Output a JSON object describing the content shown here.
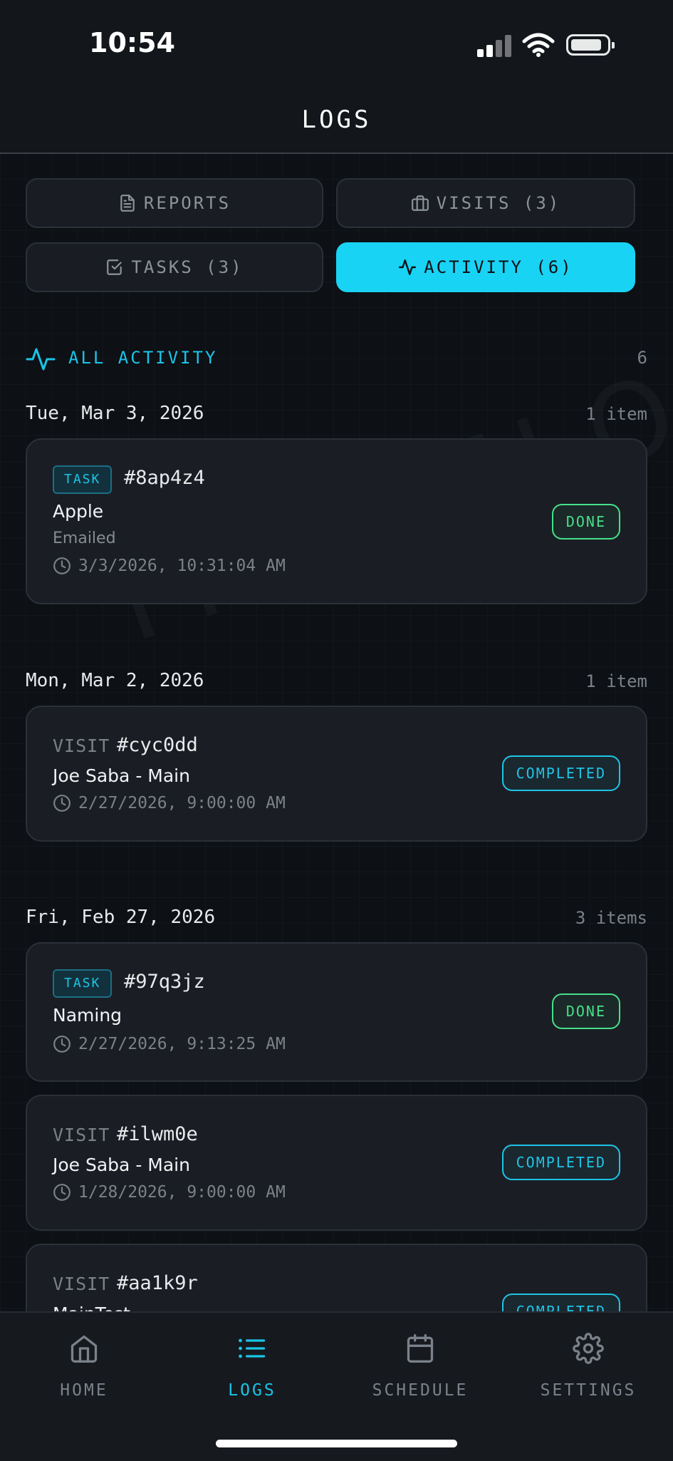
{
  "status_bar": {
    "time": "10:54"
  },
  "header": {
    "title": "LOGS"
  },
  "segments": {
    "reports": "REPORTS",
    "visits": "VISITS (3)",
    "tasks": "TASKS (3)",
    "activity": "ACTIVITY (6)"
  },
  "section": {
    "title": "ALL ACTIVITY",
    "count": "6"
  },
  "watermark": "TRACELOCK",
  "groups": [
    {
      "date": "Tue, Mar 3, 2026",
      "count": "1 item",
      "entries": [
        {
          "kind": "TASK",
          "id": "#8ap4z4",
          "name": "Apple",
          "note": "Emailed",
          "time": "3/3/2026, 10:31:04 AM",
          "status": "DONE"
        }
      ]
    },
    {
      "date": "Mon, Mar 2, 2026",
      "count": "1 item",
      "entries": [
        {
          "kind": "VISIT",
          "id": "#cyc0dd",
          "name": "Joe Saba - Main",
          "time": "2/27/2026, 9:00:00 AM",
          "status": "COMPLETED"
        }
      ]
    },
    {
      "date": "Fri, Feb 27, 2026",
      "count": "3 items",
      "entries": [
        {
          "kind": "TASK",
          "id": "#97q3jz",
          "name": "Naming",
          "time": "2/27/2026, 9:13:25 AM",
          "status": "DONE"
        },
        {
          "kind": "VISIT",
          "id": "#ilwm0e",
          "name": "Joe Saba - Main",
          "time": "1/28/2026, 9:00:00 AM",
          "status": "COMPLETED"
        },
        {
          "kind": "VISIT",
          "id": "#aa1k9r",
          "name": "MainTest",
          "status": "COMPLETED"
        }
      ]
    }
  ],
  "tab_bar": {
    "home": "HOME",
    "logs": "LOGS",
    "schedule": "SCHEDULE",
    "settings": "SETTINGS"
  },
  "colors": {
    "accent": "#19d3f5",
    "done": "#46e08a",
    "background": "#0d1014",
    "card": "#1a1e24"
  }
}
